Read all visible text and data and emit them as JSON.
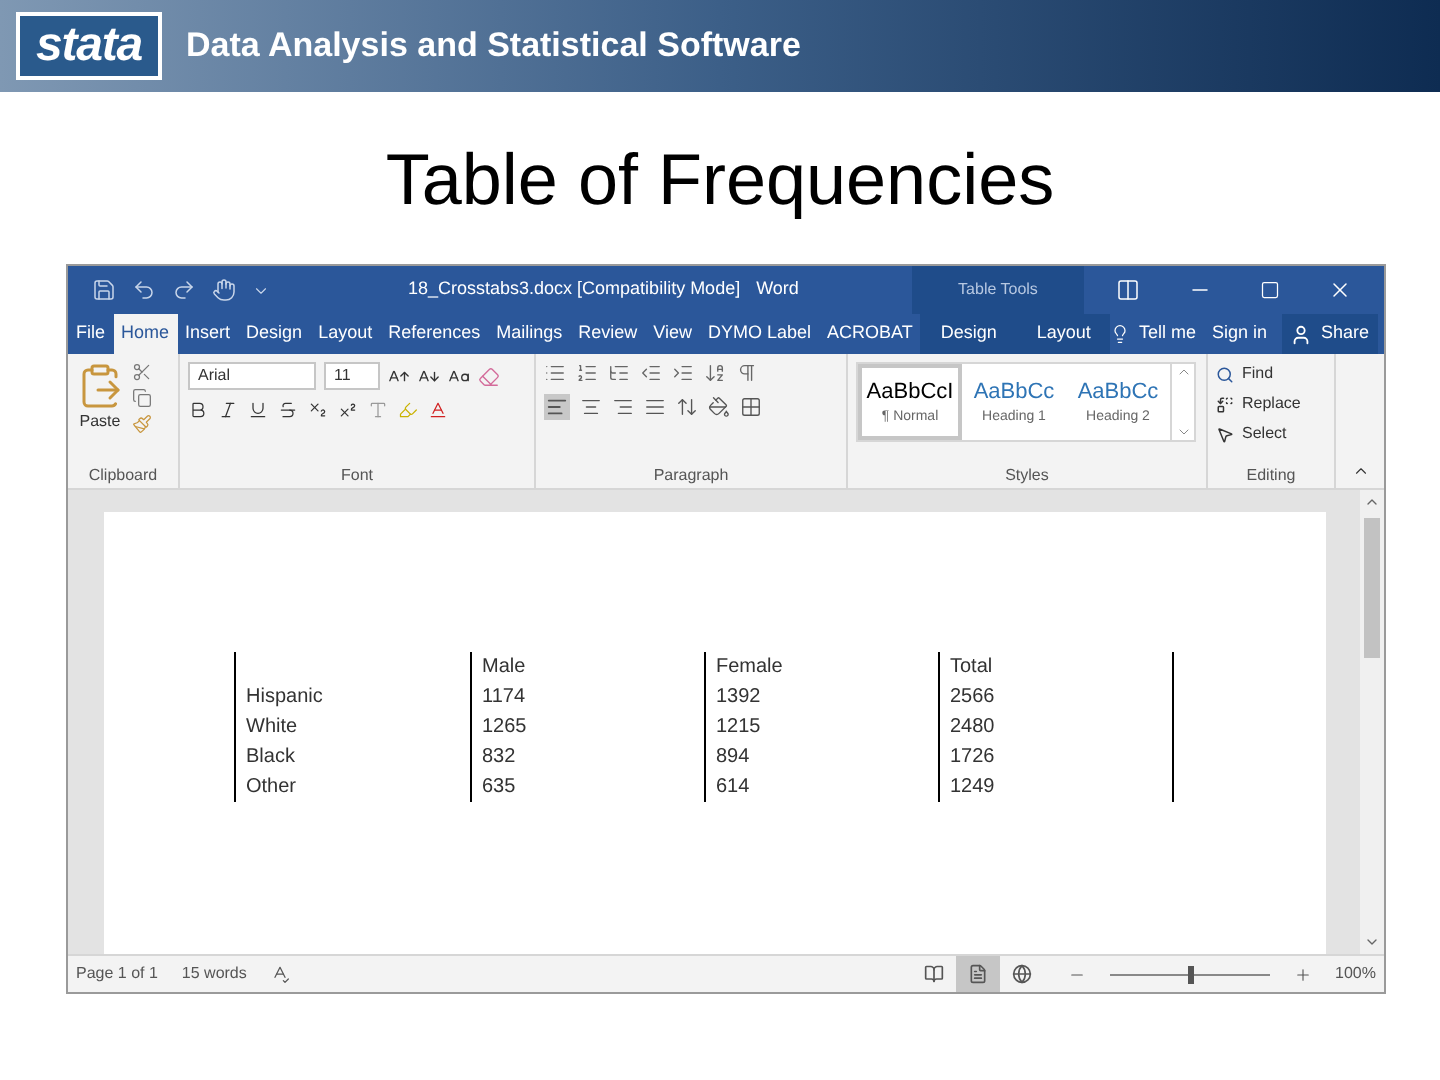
{
  "header": {
    "logo": "stata",
    "tagline": "Data Analysis and Statistical Software"
  },
  "slide_title": "Table of Frequencies",
  "word": {
    "title": "18_Crosstabs3.docx [Compatibility Mode]",
    "app": "Word",
    "context_group": "Table Tools",
    "tabs": [
      {
        "label": "File",
        "selected": false,
        "context": false
      },
      {
        "label": "Home",
        "selected": true,
        "context": false
      },
      {
        "label": "Insert",
        "selected": false,
        "context": false
      },
      {
        "label": "Design",
        "selected": false,
        "context": false
      },
      {
        "label": "Layout",
        "selected": false,
        "context": false
      },
      {
        "label": "References",
        "selected": false,
        "context": false
      },
      {
        "label": "Mailings",
        "selected": false,
        "context": false
      },
      {
        "label": "Review",
        "selected": false,
        "context": false
      },
      {
        "label": "View",
        "selected": false,
        "context": false
      },
      {
        "label": "DYMO Label",
        "selected": false,
        "context": false
      },
      {
        "label": "ACROBAT",
        "selected": false,
        "context": false
      },
      {
        "label": "Design",
        "selected": false,
        "context": true
      },
      {
        "label": "Layout",
        "selected": false,
        "context": true
      }
    ],
    "tell_me": "Tell me",
    "sign_in": "Sign in",
    "share": "Share",
    "paste": "Paste",
    "font": {
      "name": "Arial",
      "size": "11"
    },
    "styles": [
      {
        "preview": "AaBbCcI",
        "name": "¶ Normal",
        "selected": true,
        "kind": "body"
      },
      {
        "preview": "AaBbCc",
        "name": "Heading 1",
        "selected": false,
        "kind": "heading"
      },
      {
        "preview": "AaBbCc",
        "name": "Heading 2",
        "selected": false,
        "kind": "heading"
      }
    ],
    "editing": [
      "Find",
      "Replace",
      "Select"
    ],
    "groups": [
      "Clipboard",
      "Font",
      "Paragraph",
      "Styles",
      "Editing"
    ],
    "table": {
      "columns": [
        "Male",
        "Female",
        "Total"
      ],
      "rows": [
        {
          "label": "Hispanic",
          "cells": [
            "1174",
            "1392",
            "2566"
          ]
        },
        {
          "label": "White",
          "cells": [
            "1265",
            "1215",
            "2480"
          ]
        },
        {
          "label": "Black",
          "cells": [
            "832",
            "894",
            "1726"
          ]
        },
        {
          "label": "Other",
          "cells": [
            "635",
            "614",
            "1249"
          ]
        }
      ]
    },
    "status": {
      "page": "Page 1 of 1",
      "words": "15 words",
      "zoom": "100%",
      "level": 0.5,
      "views": [
        {
          "kind": "read",
          "selected": false
        },
        {
          "kind": "print",
          "selected": true
        },
        {
          "kind": "web",
          "selected": false
        }
      ]
    }
  }
}
